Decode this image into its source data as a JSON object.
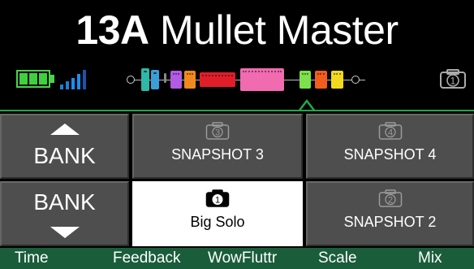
{
  "preset": {
    "number": "13A",
    "name": "Mullet Master"
  },
  "status": {
    "snapshot_number": "1"
  },
  "bank_up": {
    "label": "BANK"
  },
  "bank_down": {
    "label": "BANK"
  },
  "snapshots": [
    {
      "number": "3",
      "label": "SNAPSHOT 3",
      "active": false
    },
    {
      "number": "4",
      "label": "SNAPSHOT 4",
      "active": false
    },
    {
      "number": "1",
      "label": "Big Solo",
      "active": true
    },
    {
      "number": "2",
      "label": "SNAPSHOT 2",
      "active": false
    }
  ],
  "params": [
    "Time",
    "Feedback",
    "WowFluttr",
    "Scale",
    "Mix"
  ],
  "chain_blocks": [
    {
      "name": "eq-block",
      "color": "#2fb7a8"
    },
    {
      "name": "comp-block",
      "color": "#3a9fd8"
    },
    {
      "name": "drive-block",
      "color": "#b25be3"
    },
    {
      "name": "drive-block-2",
      "color": "#f08a1e"
    },
    {
      "name": "amp-block",
      "color": "#e01e2a"
    },
    {
      "name": "cab-block",
      "color": "#f06bb0"
    },
    {
      "name": "mod-block",
      "color": "#7ee04a"
    },
    {
      "name": "delay-block",
      "color": "#f25c1e"
    },
    {
      "name": "reverb-block",
      "color": "#f2d91e"
    }
  ],
  "colors": {
    "accent": "#23a84a",
    "footer": "#1a5d3b",
    "tile": "#4e4e4e"
  }
}
